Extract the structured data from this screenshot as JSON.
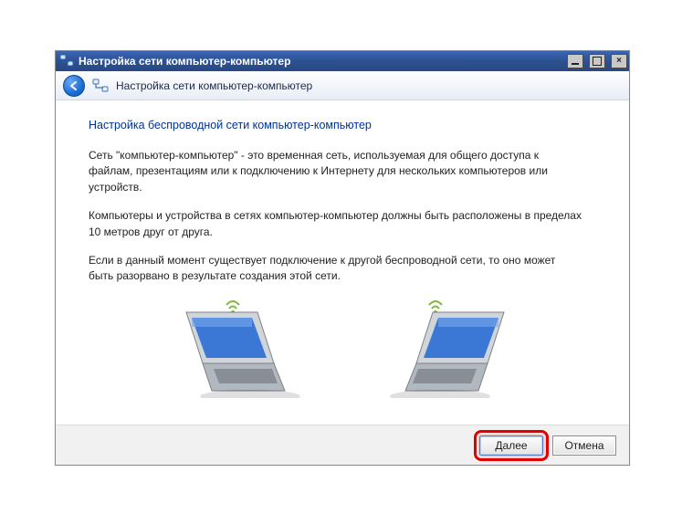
{
  "window": {
    "title": "Настройка сети компьютер-компьютер"
  },
  "header": {
    "breadcrumb": "Настройка сети компьютер-компьютер"
  },
  "content": {
    "heading": "Настройка беспроводной сети компьютер-компьютер",
    "para1": "Сеть \"компьютер-компьютер\" - это временная сеть, используемая для общего доступа к файлам, презентациям или к подключению к Интернету для нескольких компьютеров или устройств.",
    "para2": "Компьютеры и устройства в сетях компьютер-компьютер должны быть расположены в пределах 10 метров друг от друга.",
    "para3": "Если в данный момент существует подключение к другой беспроводной сети, то оно может быть разорвано в результате создания этой сети."
  },
  "buttons": {
    "next": "Далее",
    "cancel": "Отмена"
  }
}
